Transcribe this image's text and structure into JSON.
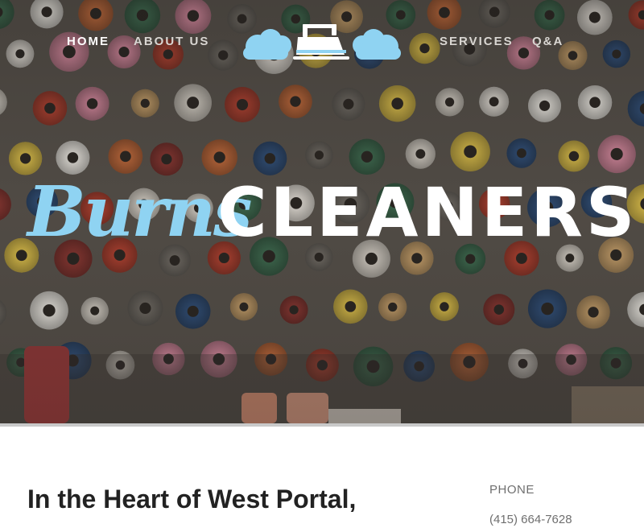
{
  "nav": {
    "items": [
      {
        "label": "HOME",
        "active": true
      },
      {
        "label": "ABOUT US",
        "active": false
      },
      {
        "label": "SERVICES",
        "active": false
      },
      {
        "label": "Q&A",
        "active": false
      }
    ]
  },
  "logo": {
    "icon": "iron-with-clouds-icon",
    "color": "#8fd3f2"
  },
  "brand": {
    "script_word": "Burns",
    "block_word": "CLEANERS",
    "script_color": "#8fd3f2",
    "block_color": "#ffffff"
  },
  "hero": {
    "background": "thread-spools-photo"
  },
  "main": {
    "heading": "In the Heart of West Portal,"
  },
  "contact": {
    "phone_label": "PHONE",
    "phone_number": "(415) 664-7628"
  }
}
